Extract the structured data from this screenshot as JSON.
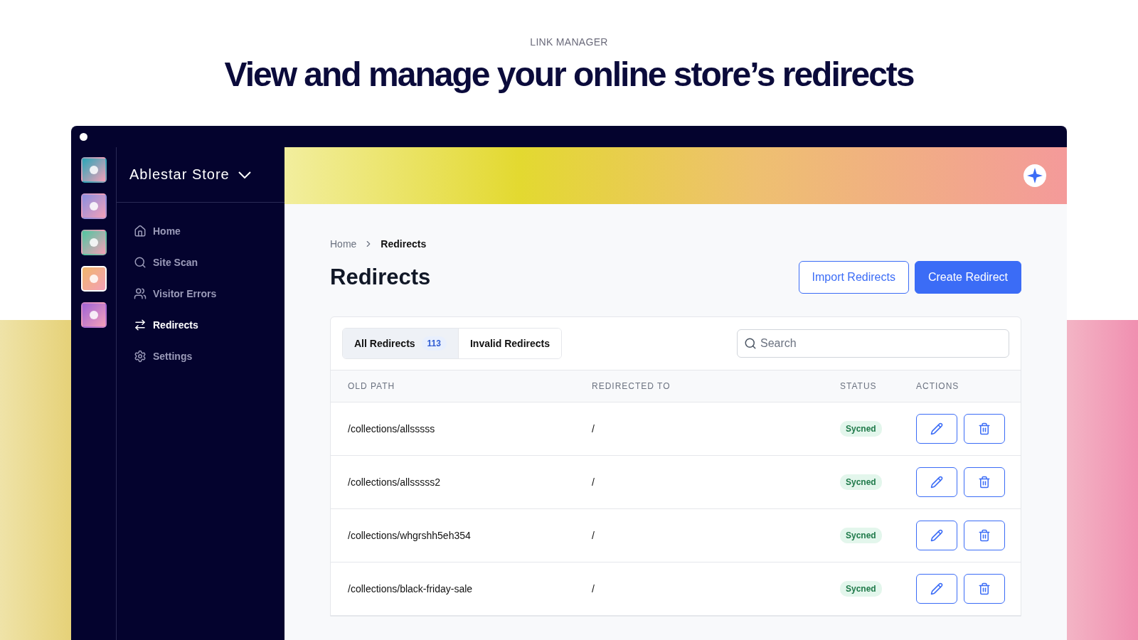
{
  "eyebrow": "LINK MANAGER",
  "headline": "View and manage your online store’s redirects",
  "app_rail": [
    {
      "selected": false
    },
    {
      "selected": false
    },
    {
      "selected": false
    },
    {
      "selected": true
    },
    {
      "selected": false
    }
  ],
  "store_switcher": {
    "label": "Ablestar Store"
  },
  "sidebar": {
    "items": [
      {
        "label": "Home",
        "selected": false
      },
      {
        "label": "Site Scan",
        "selected": false
      },
      {
        "label": "Visitor Errors",
        "selected": false
      },
      {
        "label": "Redirects",
        "selected": true
      },
      {
        "label": "Settings",
        "selected": false
      }
    ]
  },
  "breadcrumb": [
    "Home",
    "Redirects"
  ],
  "page_title": "Redirects",
  "buttons": [
    {
      "label": "Import Redirects",
      "kind": "secondary"
    },
    {
      "label": "Create Redirect",
      "kind": "primary"
    }
  ],
  "tabs": [
    {
      "label": "All Redirects",
      "count": "113",
      "selected": true
    },
    {
      "label": "Invalid Redirects",
      "selected": false
    }
  ],
  "search": {
    "placeholder": "Search"
  },
  "table": {
    "columns": [
      "OLD PATH",
      "REDIRECTED TO",
      "STATUS",
      "ACTIONS"
    ],
    "rows": [
      {
        "old_path": "/collections/allsssss",
        "redirected_to": "/",
        "status": "Sycned"
      },
      {
        "old_path": "/collections/allsssss2",
        "redirected_to": "/",
        "status": "Sycned"
      },
      {
        "old_path": "/collections/whgrshh5eh354",
        "redirected_to": "/",
        "status": "Sycned"
      },
      {
        "old_path": "/collections/black-friday-sale",
        "redirected_to": "/",
        "status": "Sycned"
      }
    ]
  }
}
